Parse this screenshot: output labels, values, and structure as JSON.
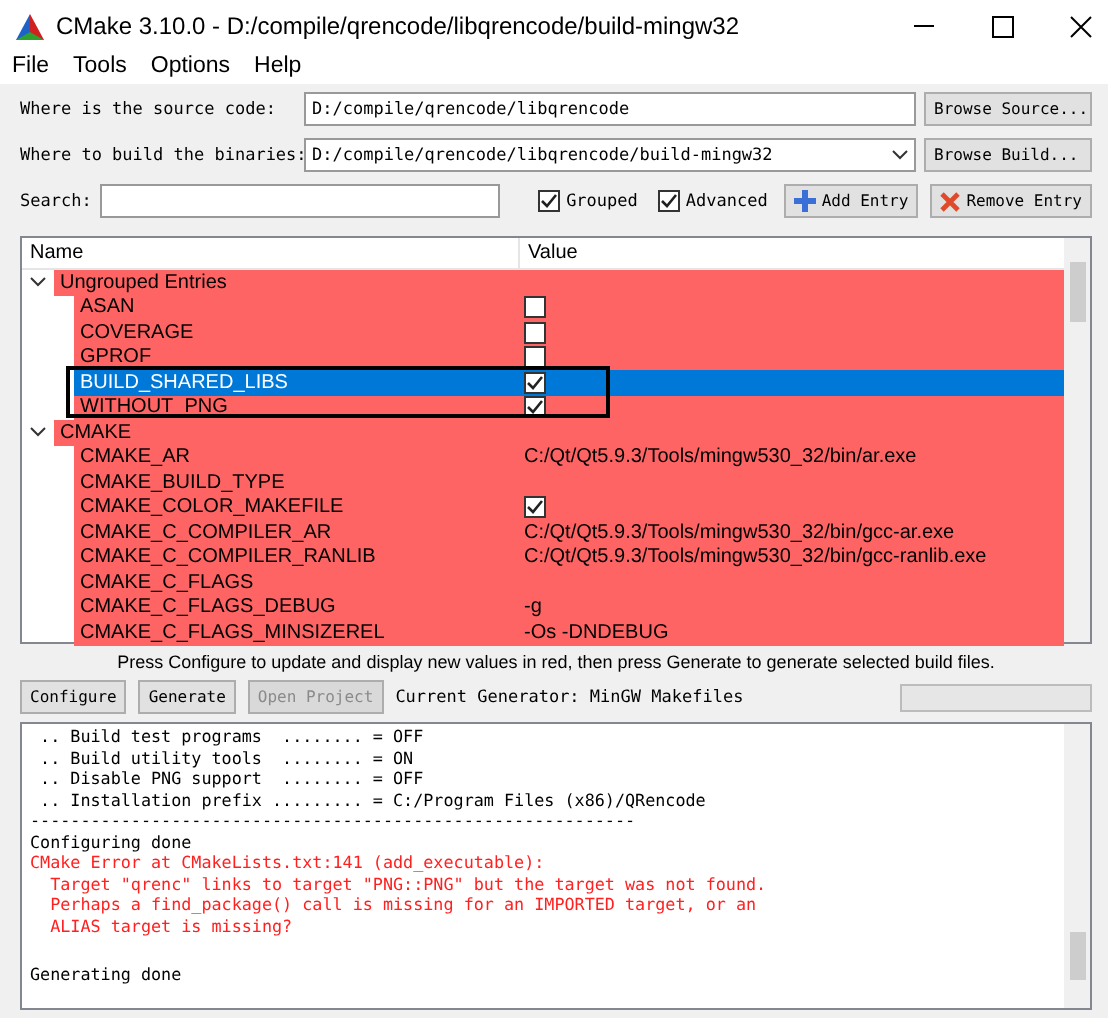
{
  "window": {
    "title": "CMake 3.10.0 - D:/compile/qrencode/libqrencode/build-mingw32"
  },
  "menu": [
    {
      "label": "File"
    },
    {
      "label": "Tools"
    },
    {
      "label": "Options"
    },
    {
      "label": "Help"
    }
  ],
  "source": {
    "label": "Where is the source code:",
    "value": "D:/compile/qrencode/libqrencode",
    "button": "Browse Source..."
  },
  "build": {
    "label": "Where to build the binaries:",
    "value": "D:/compile/qrencode/libqrencode/build-mingw32",
    "button": "Browse Build..."
  },
  "search": {
    "label": "Search:"
  },
  "options": [
    {
      "label": "Grouped",
      "checked": true
    },
    {
      "label": "Advanced",
      "checked": true
    }
  ],
  "entry_buttons": [
    {
      "label": "Add Entry",
      "kind": "add"
    },
    {
      "label": "Remove Entry",
      "kind": "remove"
    }
  ],
  "table": {
    "columns": [
      "Name",
      "Value"
    ],
    "rows": [
      {
        "kind": "group",
        "name": "Ungrouped Entries",
        "expanded": true
      },
      {
        "kind": "bool",
        "name": "ASAN",
        "checked": false,
        "selected": false
      },
      {
        "kind": "bool",
        "name": "COVERAGE",
        "checked": false,
        "selected": false
      },
      {
        "kind": "bool",
        "name": "GPROF",
        "checked": false,
        "selected": false
      },
      {
        "kind": "bool",
        "name": "BUILD_SHARED_LIBS",
        "checked": true,
        "selected": true,
        "highlighted": true
      },
      {
        "kind": "bool",
        "name": "WITHOUT_PNG",
        "checked": true,
        "selected": false,
        "highlighted": true
      },
      {
        "kind": "group",
        "name": "CMAKE",
        "expanded": true
      },
      {
        "kind": "text",
        "name": "CMAKE_AR",
        "value": "C:/Qt/Qt5.9.3/Tools/mingw530_32/bin/ar.exe",
        "selected": false
      },
      {
        "kind": "text",
        "name": "CMAKE_BUILD_TYPE",
        "selected": false
      },
      {
        "kind": "bool",
        "name": "CMAKE_COLOR_MAKEFILE",
        "checked": true,
        "selected": false
      },
      {
        "kind": "text",
        "name": "CMAKE_C_COMPILER_AR",
        "value": "C:/Qt/Qt5.9.3/Tools/mingw530_32/bin/gcc-ar.exe",
        "selected": false
      },
      {
        "kind": "text",
        "name": "CMAKE_C_COMPILER_RANLIB",
        "value": "C:/Qt/Qt5.9.3/Tools/mingw530_32/bin/gcc-ranlib.exe",
        "selected": false
      },
      {
        "kind": "text",
        "name": "CMAKE_C_FLAGS",
        "selected": false
      },
      {
        "kind": "text",
        "name": "CMAKE_C_FLAGS_DEBUG",
        "value": "-g",
        "selected": false
      },
      {
        "kind": "text",
        "name": "CMAKE_C_FLAGS_MINSIZEREL",
        "value": "-Os -DNDEBUG",
        "selected": false
      }
    ]
  },
  "hint": "Press Configure to update and display new values in red, then press Generate to generate selected build files.",
  "actions": [
    {
      "label": "Configure",
      "disabled": false
    },
    {
      "label": "Generate",
      "disabled": false
    },
    {
      "label": "Open Project",
      "disabled": true
    }
  ],
  "generator": "Current Generator: MinGW Makefiles",
  "progress": {
    "level": 0
  },
  "log": [
    {
      "text": " .. Build test programs  ........ = OFF",
      "kind": "normal"
    },
    {
      "text": " .. Build utility tools  ........ = ON",
      "kind": "normal"
    },
    {
      "text": " .. Disable PNG support  ........ = OFF",
      "kind": "normal"
    },
    {
      "text": " .. Installation prefix ......... = C:/Program Files (x86)/QRencode",
      "kind": "normal"
    },
    {
      "text": "------------------------------------------------------------",
      "kind": "normal"
    },
    {
      "text": "Configuring done",
      "kind": "normal"
    },
    {
      "text": "CMake Error at CMakeLists.txt:141 (add_executable):",
      "kind": "error"
    },
    {
      "text": "  Target \"qrenc\" links to target \"PNG::PNG\" but the target was not found.",
      "kind": "error"
    },
    {
      "text": "  Perhaps a find_package() call is missing for an IMPORTED target, or an",
      "kind": "error"
    },
    {
      "text": "  ALIAS target is missing?",
      "kind": "error"
    },
    {
      "text": "Generating done",
      "kind": "normal",
      "gap_before": true
    }
  ]
}
